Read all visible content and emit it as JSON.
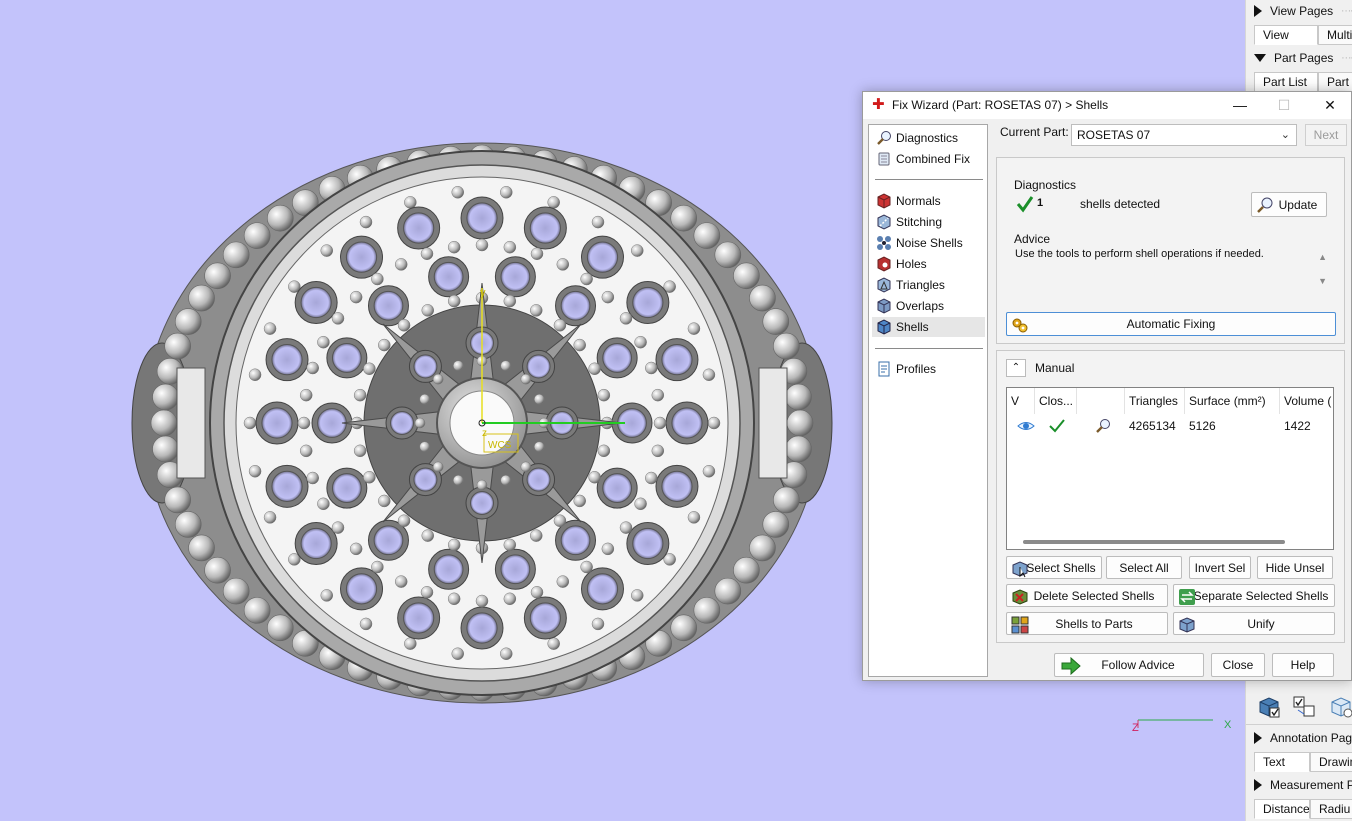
{
  "viewport": {
    "axis_labels": {
      "y": "y",
      "z": "z",
      "wcs": "WCS"
    },
    "mini_axis": {
      "z": "Z",
      "x": "X"
    }
  },
  "right_panel": {
    "view_pages": "View Pages",
    "view_tabs": [
      "View",
      "Multi-S"
    ],
    "part_pages": "Part Pages",
    "part_tabs": [
      "Part List",
      "Part I"
    ],
    "annotation_pages": "Annotation Page",
    "annotation_tabs": [
      "Text",
      "Drawing"
    ],
    "measurement_pages": "Measurement Pa",
    "measurement_tabs": [
      "Distance",
      "Radiu"
    ]
  },
  "dialog": {
    "title": "Fix Wizard (Part: ROSETAS 07) > Shells",
    "controls": {
      "minimize": "—",
      "maximize": "☐",
      "close": "✕"
    },
    "nav_top": [
      {
        "label": "Diagnostics",
        "icon": "magnifier-icon"
      },
      {
        "label": "Combined Fix",
        "icon": "combined-fix-icon"
      }
    ],
    "nav_fix": [
      {
        "label": "Normals",
        "icon": "normals-icon"
      },
      {
        "label": "Stitching",
        "icon": "stitching-icon"
      },
      {
        "label": "Noise Shells",
        "icon": "noise-shells-icon"
      },
      {
        "label": "Holes",
        "icon": "holes-icon"
      },
      {
        "label": "Triangles",
        "icon": "triangles-icon"
      },
      {
        "label": "Overlaps",
        "icon": "overlaps-icon"
      },
      {
        "label": "Shells",
        "icon": "shells-icon"
      }
    ],
    "nav_bottom": [
      {
        "label": "Profiles",
        "icon": "profiles-icon"
      }
    ],
    "current_part_label": "Current Part:",
    "current_part_value": "ROSETAS 07",
    "next_label": "Next",
    "diagnostics": {
      "label": "Diagnostics",
      "count": "1",
      "text": "shells detected",
      "update_label": "Update"
    },
    "advice": {
      "label": "Advice",
      "text": "Use the tools to perform shell operations if needed."
    },
    "automatic_fixing_label": "Automatic Fixing",
    "manual_label": "Manual",
    "table": {
      "headers": [
        "V",
        "Clos...",
        "",
        "Triangles",
        "Surface (mm²)",
        "Volume ("
      ],
      "rows": [
        {
          "visible": "eye-icon",
          "closed": "check-icon",
          "tool": "magnifier-icon",
          "triangles": "4265134",
          "surface": "5126",
          "volume": "1422"
        }
      ]
    },
    "buttons": {
      "select_shells": "Select Shells",
      "select_all": "Select All",
      "invert_sel": "Invert Sel",
      "hide_unsel": "Hide Unsel",
      "delete_selected": "Delete Selected Shells",
      "separate_selected": "Separate Selected Shells",
      "shells_to_parts": "Shells to Parts",
      "unify": "Unify",
      "follow_advice": "Follow Advice",
      "close": "Close",
      "help": "Help"
    }
  }
}
